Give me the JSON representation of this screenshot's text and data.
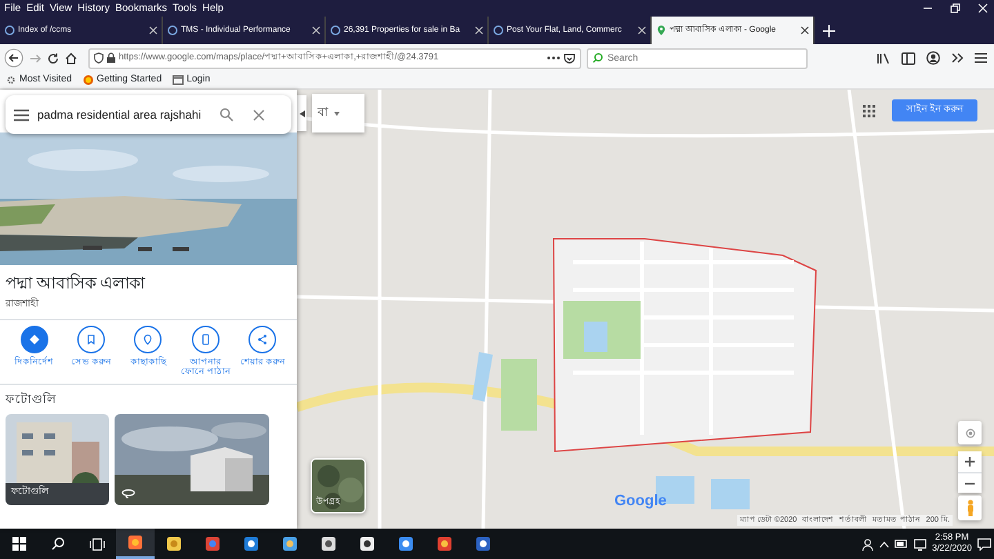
{
  "menu": [
    "File",
    "Edit",
    "View",
    "History",
    "Bookmarks",
    "Tools",
    "Help"
  ],
  "tabs": [
    {
      "label": "Index of /ccms",
      "selected": false
    },
    {
      "label": "TMS - Individual Performance",
      "selected": false
    },
    {
      "label": "26,391 Properties for sale in Ba",
      "selected": false
    },
    {
      "label": "Post Your Flat, Land, Commerc",
      "selected": false
    },
    {
      "label": "পদ্মা আবাসিক এলাকা - Google",
      "selected": true
    }
  ],
  "toolbar": {
    "url": "https://www.google.com/maps/place/পদ্মা+আবাসিক+এলাকা,+রাজশাহী/@24.3791",
    "search_placeholder": "Search"
  },
  "bookmarks": [
    "Most Visited",
    "Getting Started",
    "Login"
  ],
  "side_panel": {
    "search_value": "padma residential area rajshahi",
    "title": "পদ্মা আবাসিক এলাকা",
    "subtitle": "রাজশাহী",
    "actions": [
      {
        "label": "দিকনির্দেশ",
        "kind": "primary"
      },
      {
        "label": "সেভ করুন",
        "kind": "save"
      },
      {
        "label": "কাছাকাছি",
        "kind": "nearby"
      },
      {
        "label": "আপনার ফোনে পাঠান",
        "kind": "phone"
      },
      {
        "label": "শেয়ার করুন",
        "kind": "share"
      }
    ],
    "photos_heading": "ফটোগুলি",
    "photos": [
      {
        "label": "ফটোগুলি"
      },
      {
        "kind": "panorama"
      }
    ]
  },
  "map": {
    "logo": "Google",
    "language_toggle": "বা",
    "sign_in": "সাইন ইন করুন",
    "layer_label": "উপগ্রহ",
    "attribution": [
      "ম্যাপ ডেটা ©2020",
      "বাংলাদেশ",
      "শর্তাবলী",
      "মতামত পাঠান",
      "200 মি."
    ]
  },
  "taskbar": {
    "time": "2:58 PM",
    "date": "3/22/2020"
  }
}
